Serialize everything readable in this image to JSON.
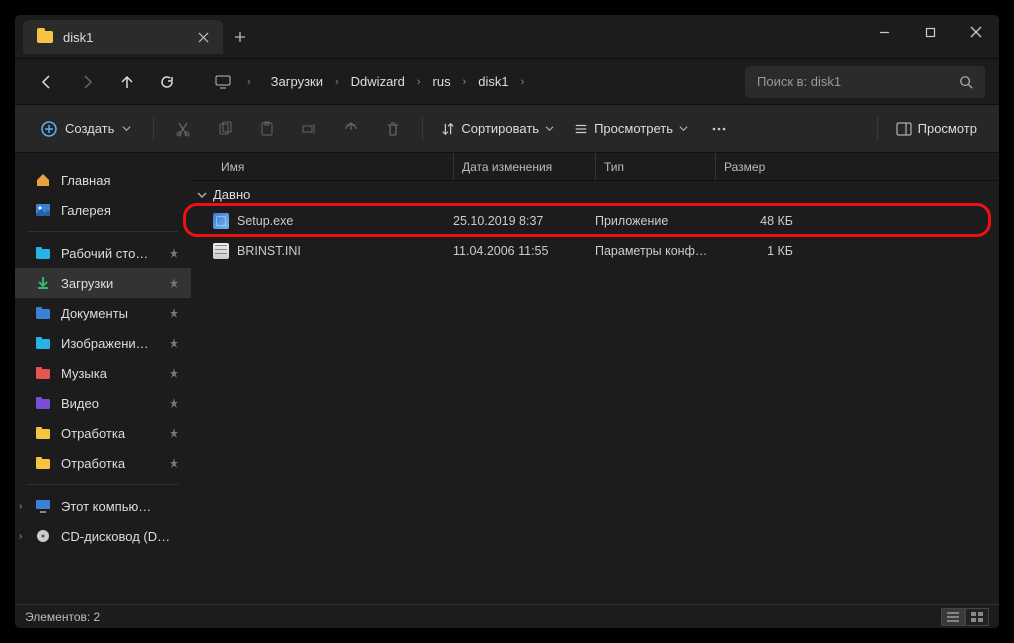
{
  "window": {
    "tab_title": "disk1",
    "new_tab": "+"
  },
  "nav": {
    "breadcrumb": [
      "Загрузки",
      "Ddwizard",
      "rus",
      "disk1"
    ],
    "search_placeholder": "Поиск в: disk1"
  },
  "toolbar": {
    "create": "Создать",
    "sort": "Сортировать",
    "view": "Просмотреть",
    "preview": "Просмотр"
  },
  "sidebar": {
    "home": "Главная",
    "gallery": "Галерея",
    "pinned": [
      {
        "label": "Рабочий сто…",
        "icon": "desktop"
      },
      {
        "label": "Загрузки",
        "icon": "downloads",
        "active": true
      },
      {
        "label": "Документы",
        "icon": "documents"
      },
      {
        "label": "Изображени…",
        "icon": "pictures"
      },
      {
        "label": "Музыка",
        "icon": "music"
      },
      {
        "label": "Видео",
        "icon": "videos"
      },
      {
        "label": "Отработка",
        "icon": "folder"
      },
      {
        "label": "Отработка",
        "icon": "folder"
      }
    ],
    "drives": [
      {
        "label": "Этот компью…",
        "icon": "pc"
      },
      {
        "label": "CD-дисковод (D…",
        "icon": "cd"
      }
    ]
  },
  "columns": {
    "name": "Имя",
    "date": "Дата изменения",
    "type": "Тип",
    "size": "Размер"
  },
  "group": {
    "title": "Давно"
  },
  "files": [
    {
      "name": "Setup.exe",
      "date": "25.10.2019 8:37",
      "type": "Приложение",
      "size": "48 КБ",
      "icon": "exe",
      "highlight": true
    },
    {
      "name": "BRINST.INI",
      "date": "11.04.2006 11:55",
      "type": "Параметры конф…",
      "size": "1 КБ",
      "icon": "ini"
    }
  ],
  "status": {
    "items_label": "Элементов: 2"
  }
}
